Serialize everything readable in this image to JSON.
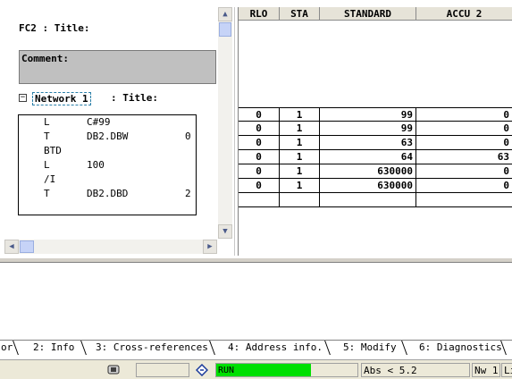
{
  "editor": {
    "block_title": "FC2 : Title:",
    "comment_label": "Comment:",
    "network_toggle": "−",
    "network_label": "Network 1",
    "network_title": ": Title:",
    "code": [
      {
        "op": "L",
        "arg": "C#99",
        "extra": ""
      },
      {
        "op": "T",
        "arg": "DB2.DBW",
        "extra": "0"
      },
      {
        "op": "BTD",
        "arg": "",
        "extra": ""
      },
      {
        "op": "L",
        "arg": "100",
        "extra": ""
      },
      {
        "op": "/I",
        "arg": "",
        "extra": ""
      },
      {
        "op": "T",
        "arg": "DB2.DBD",
        "extra": "2"
      }
    ]
  },
  "table": {
    "headers": [
      "RLO",
      "STA",
      "STANDARD",
      "ACCU 2"
    ],
    "rows": [
      [
        "0",
        "1",
        "99",
        "0"
      ],
      [
        "0",
        "1",
        "99",
        "0"
      ],
      [
        "0",
        "1",
        "63",
        "0"
      ],
      [
        "0",
        "1",
        "64",
        "63"
      ],
      [
        "0",
        "1",
        "630000",
        "0"
      ],
      [
        "0",
        "1",
        "630000",
        "0"
      ],
      [
        "",
        "",
        "",
        ""
      ]
    ]
  },
  "tabs": [
    {
      "label": "or"
    },
    {
      "label": "2: Info"
    },
    {
      "label": "3: Cross-references"
    },
    {
      "label": "4: Address info."
    },
    {
      "label": "5: Modify"
    },
    {
      "label": "6: Diagnostics"
    }
  ],
  "status": {
    "run_text": "RUN",
    "address_mode": "Abs < 5.2",
    "network_pos": "Nw 1",
    "line_pos": "Li",
    "run_color": "#00e000"
  }
}
